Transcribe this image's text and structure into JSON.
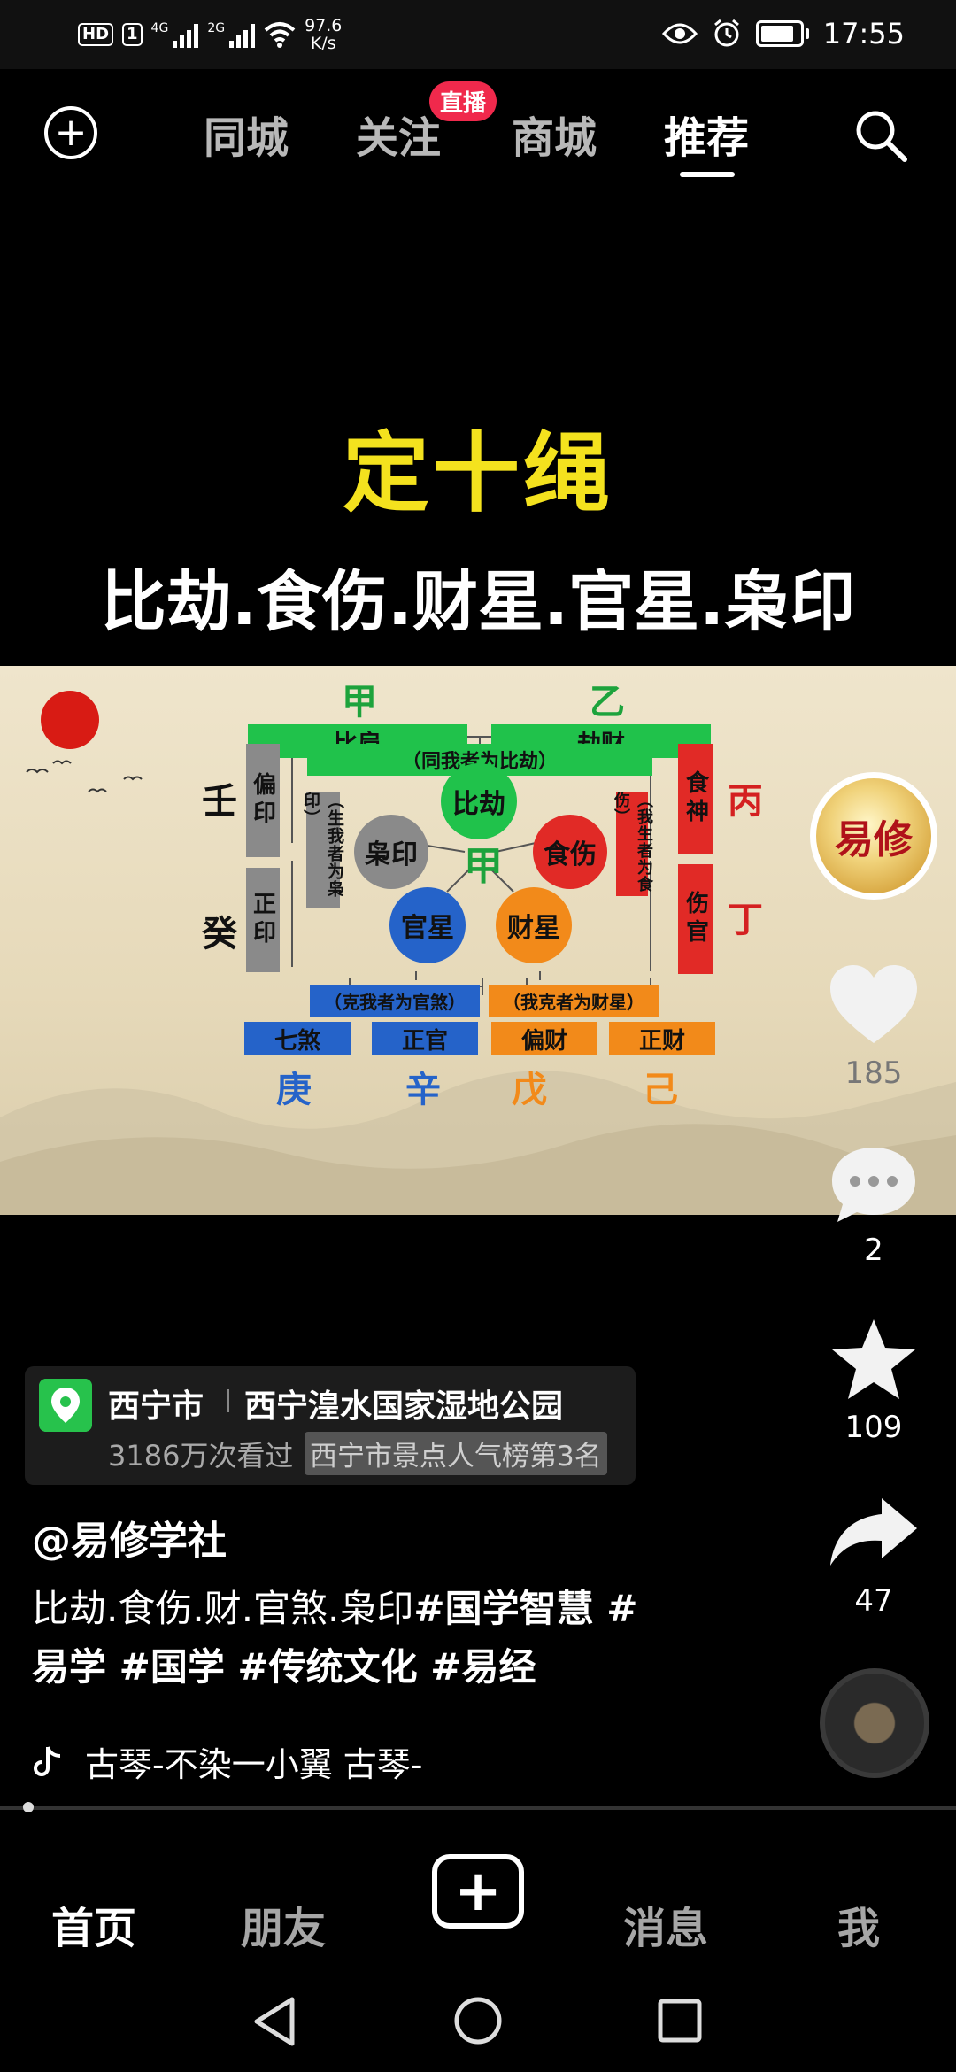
{
  "status_bar": {
    "hd": "HD",
    "sim": "1",
    "net1": "4G",
    "net2": "2G",
    "speed_value": "97.6",
    "speed_unit": "K/s",
    "time": "17:55",
    "icons": [
      "eye-icon",
      "alarm-icon",
      "battery-icon"
    ]
  },
  "top_nav": {
    "tabs": [
      "同城",
      "关注",
      "商城",
      "推荐"
    ],
    "active_tab": "推荐",
    "live_badge": "直播"
  },
  "video": {
    "title": "定十绳",
    "subtitle": "比劫.食伤.财星.官星.枭印",
    "diagram": {
      "top_stems": [
        "甲",
        "乙"
      ],
      "top_boxes": [
        "比肩",
        "劫财"
      ],
      "same_rule": "（同我者为比劫）",
      "center_circle": "比劫",
      "center_stem": "甲",
      "left_stems": [
        "壬",
        "癸"
      ],
      "left_boxes": [
        "偏印",
        "正印"
      ],
      "left_rule": "（生我者为枭印）",
      "circle_resource": "枭印",
      "circle_output": "食伤",
      "circle_officer": "官星",
      "circle_wealth": "财星",
      "right_stems": [
        "丙",
        "丁"
      ],
      "right_boxes": [
        "食神",
        "伤官"
      ],
      "right_rule": "（我生者为食伤）",
      "officer_rule": "（克我者为官煞）",
      "wealth_rule": "（我克者为财星）",
      "bottom_boxes": [
        "七煞",
        "正官",
        "偏财",
        "正财"
      ],
      "bottom_stems": [
        "庚",
        "辛",
        "戊",
        "己"
      ]
    }
  },
  "actions": {
    "avatar_text": "易修",
    "likes": "185",
    "comments": "2",
    "favorites": "109",
    "shares": "47"
  },
  "location": {
    "city": "西宁市",
    "place": "西宁湟水国家湿地公园",
    "views": "3186万次看过",
    "rank": "西宁市景点人气榜第3名"
  },
  "post": {
    "author": "@易修学社",
    "desc_plain": "比劫.食伤.财.官煞.枭印",
    "tags_line1": "#国学智慧 #",
    "tags_line2": "易学 #国学 #传统文化 #易经",
    "music": "古琴-不染一小翼    古琴-"
  },
  "bottom_nav": {
    "home": "首页",
    "friends": "朋友",
    "messages": "消息",
    "me": "我",
    "create_symbol": "+"
  },
  "colors": {
    "live_red": "#f0294c",
    "title_yellow": "#f4e21e",
    "location_green": "#27c24c"
  }
}
